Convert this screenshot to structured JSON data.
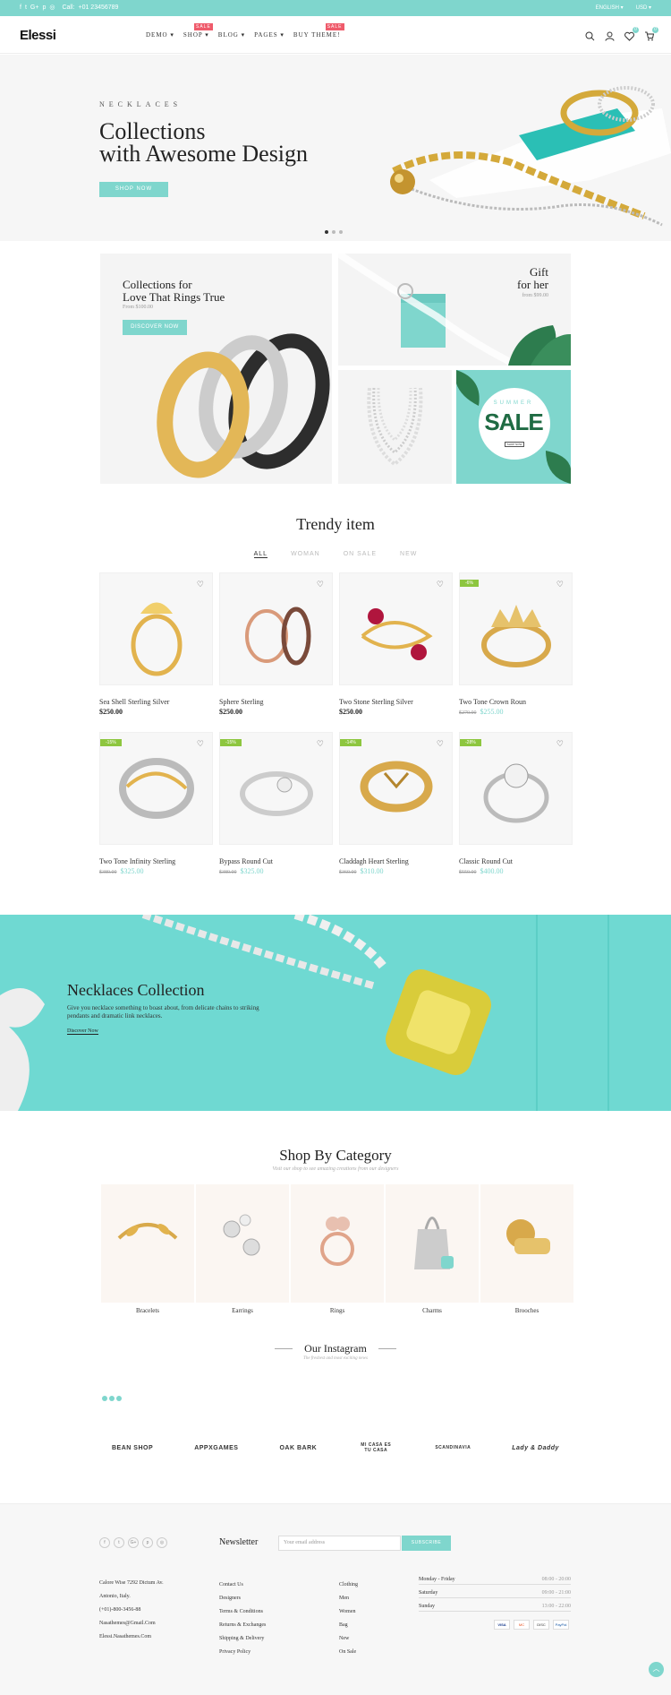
{
  "topbar": {
    "social_icons": [
      "facebook-icon",
      "twitter-icon",
      "google-plus-icon",
      "pinterest-icon",
      "instagram-icon"
    ],
    "call_label": "Call:",
    "phone": "+01 23456789",
    "language": "ENGLISH",
    "currency": "USD"
  },
  "header": {
    "logo": "Elessi",
    "nav": [
      {
        "label": "DEMO",
        "badge": ""
      },
      {
        "label": "SHOP",
        "badge": "SALE"
      },
      {
        "label": "BLOG",
        "badge": ""
      },
      {
        "label": "PAGES",
        "badge": ""
      },
      {
        "label": "BUY THEME!",
        "badge": "SALE"
      }
    ],
    "wishlist_count": "0",
    "cart_count": "0"
  },
  "hero": {
    "subtitle": "NECKLACES",
    "title_line1": "Collections",
    "title_line2": "with Awesome Design",
    "button": "SHOP NOW"
  },
  "banners": {
    "rings": {
      "title_line1": "Collections for",
      "title_line2": "Love That Rings True",
      "price": "From $100.00",
      "button": "DISCOVER NOW"
    },
    "gift": {
      "title_line1": "Gift",
      "title_line2": "for her",
      "price": "from $99.00"
    },
    "sale": {
      "small": "SUMMER",
      "big": "SALE",
      "button": "SHOP NOW"
    }
  },
  "trendy": {
    "title": "Trendy item",
    "tabs": [
      "ALL",
      "WOMAN",
      "ON SALE",
      "NEW"
    ],
    "products": [
      {
        "name": "Sea Shell Sterling Silver",
        "price": "$250.00",
        "old": "",
        "sale": ""
      },
      {
        "name": "Sphere Sterling",
        "price": "$250.00",
        "old": "",
        "sale": ""
      },
      {
        "name": "Two Stone Sterling Silver",
        "price": "$250.00",
        "old": "",
        "sale": ""
      },
      {
        "name": "Two Tone Crown Roun",
        "price": "$255.00",
        "old": "$270.00",
        "sale": "-6%"
      },
      {
        "name": "Two Tone Infinity Sterling",
        "price": "$325.00",
        "old": "$380.00",
        "sale": "-15%"
      },
      {
        "name": "Bypass Round Cut",
        "price": "$325.00",
        "old": "$380.00",
        "sale": "-15%"
      },
      {
        "name": "Claddagh Heart Sterling",
        "price": "$310.00",
        "old": "$360.00",
        "sale": "-14%"
      },
      {
        "name": "Classic Round Cut",
        "price": "$400.00",
        "old": "$550.00",
        "sale": "-28%"
      }
    ]
  },
  "necklaces": {
    "title": "Necklaces Collection",
    "description": "Give you necklace something to boast about, from delicate chains to striking pendants and dramatic link necklaces.",
    "link": "Discover Now"
  },
  "category": {
    "title": "Shop By Category",
    "subtitle": "Visit our shop to see amazing creations from our designers",
    "items": [
      "Bracelets",
      "Earrings",
      "Rings",
      "Charms",
      "Brooches"
    ]
  },
  "instagram": {
    "title": "Our Instagram",
    "subtitle": "The freshest and most exciting news"
  },
  "brands": [
    "BEAN SHOP",
    "APPXGAMES",
    "OAK BARK",
    "MI CASA ES TU CASA",
    "SCANDINAVIA",
    "Lady & Daddy"
  ],
  "footer": {
    "social_icons": [
      "facebook-icon",
      "twitter-icon",
      "google-plus-icon",
      "pinterest-icon",
      "instagram-icon"
    ],
    "address_line1": "Calore Wise 7292 Dictum Av.",
    "address_line2": "Antonio, Italy.",
    "phone": "(+01)-800-3456-88",
    "email": "Nasathemes@Gmail.Com",
    "website": "Elessi.Nasathemes.Com",
    "newsletter_title": "Newsletter",
    "newsletter_placeholder": "Your email address",
    "newsletter_button": "SUBSCRIBE",
    "links_col1": [
      "Contact Us",
      "Designers",
      "Terms & Conditions",
      "Returns & Exchanges",
      "Shipping & Delivery",
      "Privacy Policy"
    ],
    "links_col2": [
      "Clothing",
      "Men",
      "Women",
      "Bag",
      "New",
      "On Sale"
    ],
    "hours": [
      {
        "day": "Monday - Friday",
        "time": "08:00 - 20:00"
      },
      {
        "day": "Saturday",
        "time": "09:00 - 21:00"
      },
      {
        "day": "Sunday",
        "time": "13:00 - 22:00"
      }
    ],
    "payment_icons": [
      "visa-icon",
      "mastercard-icon",
      "discover-icon",
      "paypal-icon"
    ],
    "payment_labels": [
      "VISA",
      "MC",
      "DISC",
      "PayPal"
    ]
  },
  "colors": {
    "accent": "#7fd6cd",
    "sale_badge": "#ef5b6b",
    "discount_badge": "#8dc63f",
    "banner_bg": "#6fd9d2"
  }
}
